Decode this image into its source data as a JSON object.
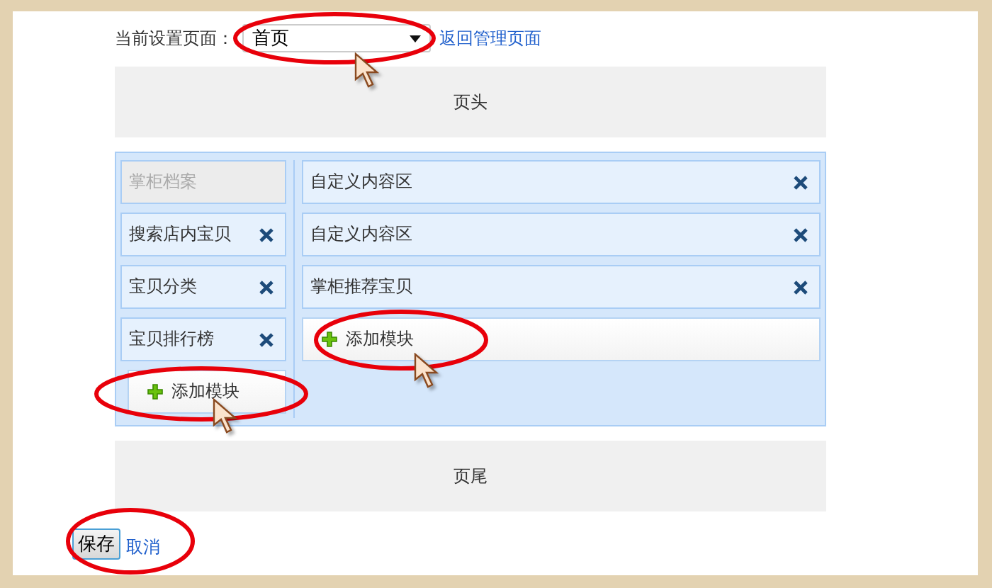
{
  "page_selector": {
    "label": "当前设置页面：",
    "value": "首页",
    "link": "返回管理页面"
  },
  "header": {
    "label": "页头"
  },
  "left_column": {
    "modules": [
      {
        "label": "掌柜档案",
        "disabled": true
      },
      {
        "label": "搜索店内宝贝",
        "disabled": false
      },
      {
        "label": "宝贝分类",
        "disabled": false
      },
      {
        "label": "宝贝排行榜",
        "disabled": false
      }
    ],
    "add_button": "添加模块"
  },
  "main_column": {
    "modules": [
      {
        "label": "自定义内容区",
        "disabled": false
      },
      {
        "label": "自定义内容区",
        "disabled": false
      },
      {
        "label": "掌柜推荐宝贝",
        "disabled": false
      }
    ],
    "add_button": "添加模块"
  },
  "footer": {
    "label": "页尾"
  },
  "actions": {
    "save": "保存",
    "cancel": "取消"
  }
}
